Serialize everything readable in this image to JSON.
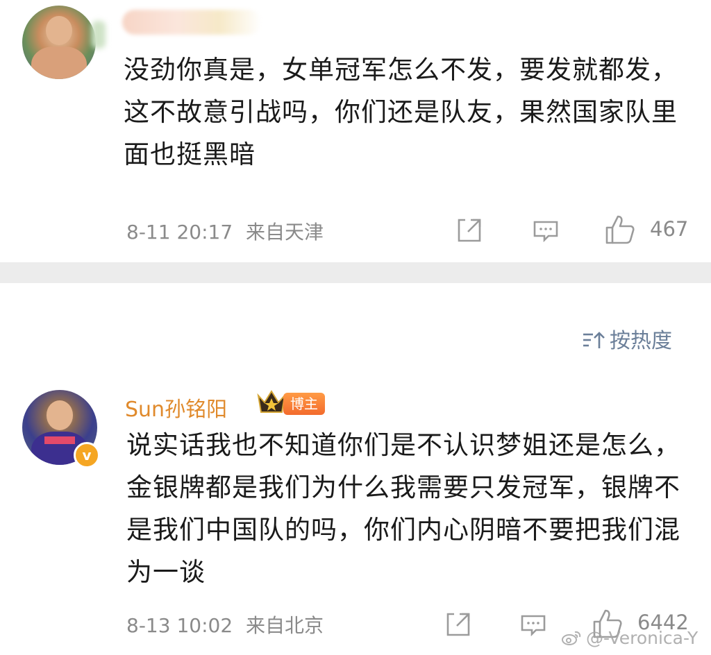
{
  "comment1": {
    "author_name": "",
    "text": "没劲你真是，女单冠军怎么不发，要发就都发，这不故意引战吗，你们还是队友，果然国家队里面也挺黑暗",
    "timestamp": "8-11 20:17",
    "location": "来自天津",
    "like_count": "467",
    "icons": [
      "share-icon",
      "comment-icon",
      "like-icon"
    ]
  },
  "sort": {
    "label": "按热度",
    "icon": "sort-icon"
  },
  "comment2": {
    "author_name": "Sun孙铭阳",
    "badge_label": "博主",
    "verified_mark": "v",
    "text": "说实话我也不知道你们是不认识梦姐还是怎么，金银牌都是我们为什么我需要只发冠军，银牌不是我们中国队的吗，你们内心阴暗不要把我们混为一谈",
    "timestamp": "8-13 10:02",
    "location": "来自北京",
    "like_count": "6442",
    "icons": [
      "share-icon",
      "comment-icon",
      "like-icon"
    ]
  },
  "watermark": {
    "text": "@-Veronica-Y",
    "icon": "weibo-icon"
  },
  "colors": {
    "author_orange": "#e08a2c",
    "badge_orange": "#f36b2d",
    "meta_gray": "#8a8a8a",
    "sort_blue": "#6b7f99",
    "divider_gray": "#ececec"
  }
}
